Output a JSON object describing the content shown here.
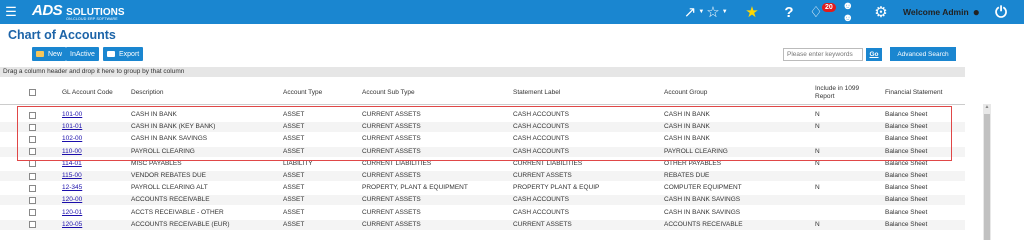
{
  "brand": {
    "logo_main": "ADS",
    "logo_sol": "SOLUTIONS",
    "logo_tag": "ON-CLOUD ERP SOFTWARE"
  },
  "topbar": {
    "notification_count": "20",
    "welcome_text": "Welcome Admin"
  },
  "page": {
    "title": "Chart of Accounts"
  },
  "toolbar": {
    "new_label": "New",
    "inactive_label": "InActive",
    "export_label": "Export"
  },
  "search": {
    "placeholder": "Please enter keywords",
    "go_label": "Go",
    "advanced_label": "Advanced Search"
  },
  "grid": {
    "group_hint": "Drag a column header and drop it here to group by that column",
    "columns": [
      "GL Account Code",
      "Description",
      "Account Type",
      "Account Sub Type",
      "Statement Label",
      "Account Group",
      "Include in 1099 Report",
      "Financial Statement"
    ],
    "rows": [
      [
        "101-00",
        "CASH IN BANK",
        "ASSET",
        "CURRENT ASSETS",
        "CASH ACCOUNTS",
        "CASH IN BANK",
        "N",
        "Balance Sheet"
      ],
      [
        "101-01",
        "CASH IN BANK (KEY BANK)",
        "ASSET",
        "CURRENT ASSETS",
        "CASH ACCOUNTS",
        "CASH IN BANK",
        "N",
        "Balance Sheet"
      ],
      [
        "102-00",
        "CASH IN BANK SAVINGS",
        "ASSET",
        "CURRENT ASSETS",
        "CASH ACCOUNTS",
        "CASH IN BANK",
        "",
        "Balance Sheet"
      ],
      [
        "110-00",
        "PAYROLL CLEARING",
        "ASSET",
        "CURRENT ASSETS",
        "CASH ACCOUNTS",
        "PAYROLL CLEARING",
        "N",
        "Balance Sheet"
      ],
      [
        "114-01",
        "MISC PAYABLES",
        "LIABILITY",
        "CURRENT LIABILITIES",
        "CURRENT LIABILITIES",
        "OTHER PAYABLES",
        "N",
        "Balance Sheet"
      ],
      [
        "115-00",
        "VENDOR REBATES DUE",
        "ASSET",
        "CURRENT ASSETS",
        "CURRENT ASSETS",
        "REBATES DUE",
        "",
        "Balance Sheet"
      ],
      [
        "12-345",
        "PAYROLL CLEARING ALT",
        "ASSET",
        "PROPERTY, PLANT & EQUIPMENT",
        "PROPERTY PLANT & EQUIP",
        "COMPUTER EQUIPMENT",
        "N",
        "Balance Sheet"
      ],
      [
        "120-00",
        "ACCOUNTS RECEIVABLE",
        "ASSET",
        "CURRENT ASSETS",
        "CASH ACCOUNTS",
        "CASH IN BANK SAVINGS",
        "",
        "Balance Sheet"
      ],
      [
        "120-01",
        "ACCTS RECEIVABLE - OTHER",
        "ASSET",
        "CURRENT ASSETS",
        "CASH ACCOUNTS",
        "CASH IN BANK SAVINGS",
        "",
        "Balance Sheet"
      ],
      [
        "120-05",
        "ACCOUNTS RECEIVABLE (EUR)",
        "ASSET",
        "CURRENT ASSETS",
        "CURRENT ASSETS",
        "ACCOUNTS RECEIVABLE",
        "N",
        "Balance Sheet"
      ]
    ]
  },
  "colors": {
    "topbar": "#1a86d0",
    "title": "#1d64a8",
    "selection_outline": "#e04747",
    "link": "#1a0dab"
  }
}
